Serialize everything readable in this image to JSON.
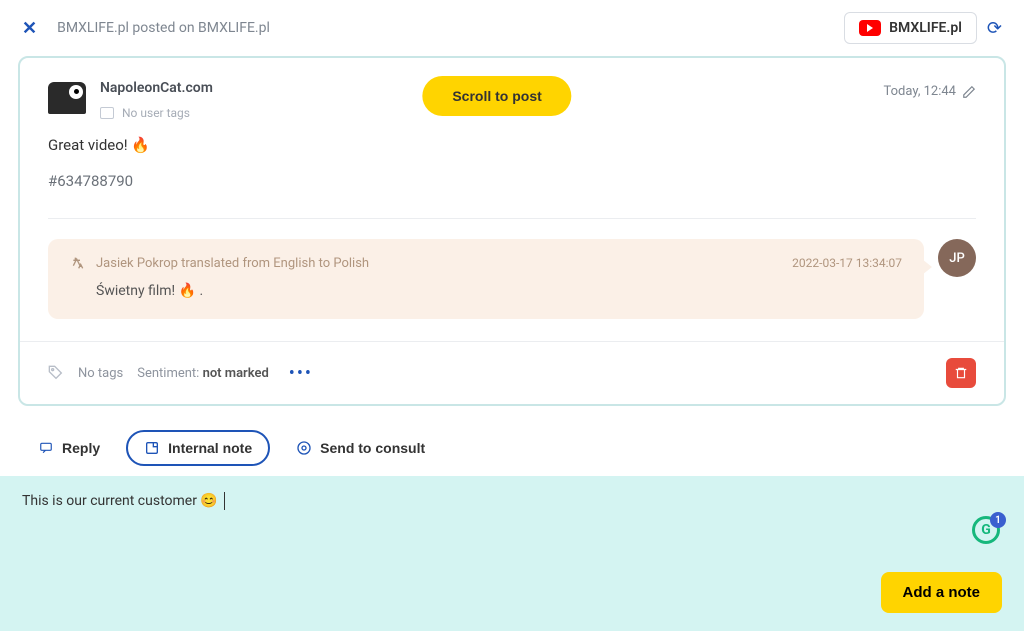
{
  "header": {
    "title": "BMXLIFE.pl posted on BMXLIFE.pl",
    "source_badge": "BMXLIFE.pl"
  },
  "post": {
    "author": "NapoleonCat.com",
    "user_tags_label": "No user tags",
    "scroll_button": "Scroll to post",
    "timestamp": "Today, 12:44",
    "text": "Great video! 🔥",
    "hash": "#634788790"
  },
  "translation": {
    "label": "Jasiek Pokrop translated from English to Polish",
    "time": "2022-03-17 13:34:07",
    "text": "Świetny film! 🔥 .",
    "avatar_initials": "JP"
  },
  "footer": {
    "no_tags": "No tags",
    "sentiment_label": "Sentiment: ",
    "sentiment_value": "not marked"
  },
  "tabs": {
    "reply": "Reply",
    "internal_note": "Internal note",
    "send_consult": "Send to consult"
  },
  "note": {
    "draft": "This is our current customer 😊",
    "add_button": "Add a note"
  },
  "grammarly": {
    "letter": "G",
    "badge_count": "1"
  }
}
